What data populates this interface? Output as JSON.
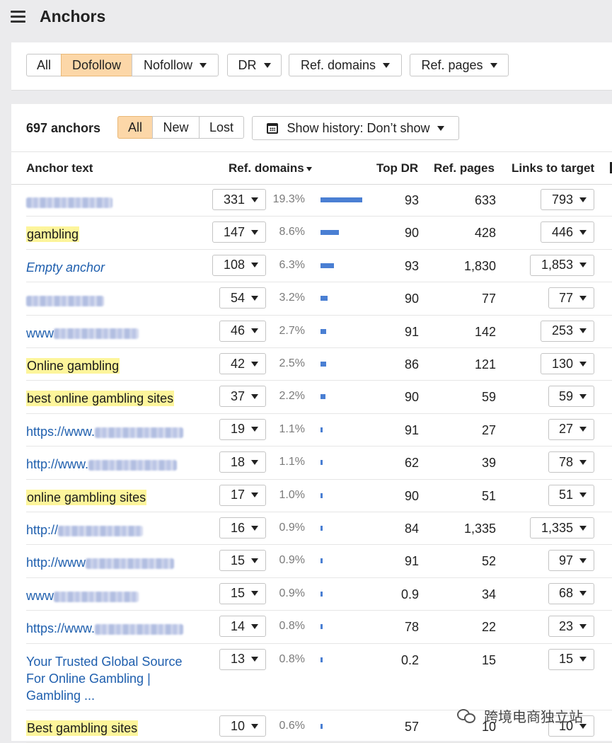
{
  "page": {
    "title": "Anchors"
  },
  "filters": {
    "type_tabs": [
      {
        "label": "All",
        "active": false
      },
      {
        "label": "Dofollow",
        "active": true
      },
      {
        "label": "Nofollow",
        "active": false
      }
    ],
    "dr_label": "DR",
    "ref_domains_label": "Ref. domains",
    "ref_pages_label": "Ref. pages"
  },
  "summary": {
    "count_label": "697 anchors",
    "status_tabs": [
      {
        "label": "All",
        "active": true
      },
      {
        "label": "New",
        "active": false
      },
      {
        "label": "Lost",
        "active": false
      }
    ],
    "history_label": "Show history: Don’t show"
  },
  "table": {
    "headers": {
      "anchor_text": "Anchor text",
      "ref_domains": "Ref. domains",
      "top_dr": "Top DR",
      "ref_pages": "Ref. pages",
      "links_to_target": "Links to target"
    },
    "rows": [
      {
        "anchor": "",
        "blurred": true,
        "highlight": false,
        "italic": false,
        "ref_domains": "331",
        "pct": "19.3%",
        "share": 0.193,
        "top_dr": "93",
        "ref_pages": "633",
        "links": "793"
      },
      {
        "anchor": "gambling",
        "blurred": false,
        "highlight": true,
        "italic": false,
        "ref_domains": "147",
        "pct": "8.6%",
        "share": 0.086,
        "top_dr": "90",
        "ref_pages": "428",
        "links": "446"
      },
      {
        "anchor": "Empty anchor",
        "blurred": false,
        "highlight": false,
        "italic": true,
        "ref_domains": "108",
        "pct": "6.3%",
        "share": 0.063,
        "top_dr": "93",
        "ref_pages": "1,830",
        "links": "1,853"
      },
      {
        "anchor": "",
        "blurred": true,
        "highlight": false,
        "italic": false,
        "ref_domains": "54",
        "pct": "3.2%",
        "share": 0.032,
        "top_dr": "90",
        "ref_pages": "77",
        "links": "77"
      },
      {
        "anchor": "www",
        "blurred": true,
        "highlight": false,
        "italic": false,
        "ref_domains": "46",
        "pct": "2.7%",
        "share": 0.027,
        "top_dr": "91",
        "ref_pages": "142",
        "links": "253"
      },
      {
        "anchor": "Online gambling",
        "blurred": false,
        "highlight": true,
        "italic": false,
        "ref_domains": "42",
        "pct": "2.5%",
        "share": 0.025,
        "top_dr": "86",
        "ref_pages": "121",
        "links": "130"
      },
      {
        "anchor": "best online gambling sites",
        "blurred": false,
        "highlight": true,
        "italic": false,
        "ref_domains": "37",
        "pct": "2.2%",
        "share": 0.022,
        "top_dr": "90",
        "ref_pages": "59",
        "links": "59"
      },
      {
        "anchor": "https://www.",
        "blurred": true,
        "highlight": false,
        "italic": false,
        "ref_domains": "19",
        "pct": "1.1%",
        "share": 0.011,
        "top_dr": "91",
        "ref_pages": "27",
        "links": "27"
      },
      {
        "anchor": "http://www.",
        "blurred": true,
        "highlight": false,
        "italic": false,
        "ref_domains": "18",
        "pct": "1.1%",
        "share": 0.011,
        "top_dr": "62",
        "ref_pages": "39",
        "links": "78"
      },
      {
        "anchor": "online gambling sites",
        "blurred": false,
        "highlight": true,
        "italic": false,
        "ref_domains": "17",
        "pct": "1.0%",
        "share": 0.01,
        "top_dr": "90",
        "ref_pages": "51",
        "links": "51"
      },
      {
        "anchor": "http://",
        "blurred": true,
        "highlight": false,
        "italic": false,
        "ref_domains": "16",
        "pct": "0.9%",
        "share": 0.009,
        "top_dr": "84",
        "ref_pages": "1,335",
        "links": "1,335"
      },
      {
        "anchor": "http://www",
        "blurred": true,
        "highlight": false,
        "italic": false,
        "ref_domains": "15",
        "pct": "0.9%",
        "share": 0.009,
        "top_dr": "91",
        "ref_pages": "52",
        "links": "97"
      },
      {
        "anchor": "www",
        "blurred": true,
        "highlight": false,
        "italic": false,
        "ref_domains": "15",
        "pct": "0.9%",
        "share": 0.009,
        "top_dr": "0.9",
        "ref_pages": "34",
        "links": "68"
      },
      {
        "anchor": "https://www.",
        "blurred": true,
        "highlight": false,
        "italic": false,
        "ref_domains": "14",
        "pct": "0.8%",
        "share": 0.008,
        "top_dr": "78",
        "ref_pages": "22",
        "links": "23"
      },
      {
        "anchor": "Your Trusted Global Source For Online Gambling | Gambling ...",
        "blurred": false,
        "highlight": false,
        "italic": false,
        "ref_domains": "13",
        "pct": "0.8%",
        "share": 0.008,
        "top_dr": "0.2",
        "ref_pages": "15",
        "links": "15"
      },
      {
        "anchor": "Best gambling sites",
        "blurred": false,
        "highlight": true,
        "italic": false,
        "ref_domains": "10",
        "pct": "0.6%",
        "share": 0.006,
        "top_dr": "57",
        "ref_pages": "10",
        "links": "10"
      }
    ]
  },
  "watermark": {
    "text": "跨境电商独立站"
  },
  "colors": {
    "active_tab": "#fcd7a8",
    "bar": "#4a7fd3",
    "highlight": "#fdf59b",
    "link": "#1f5fae"
  }
}
